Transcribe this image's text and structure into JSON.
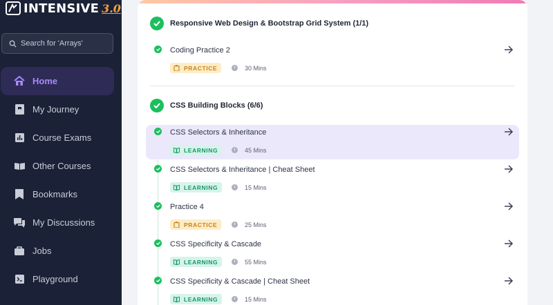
{
  "sidebar": {
    "logo_text": "INTENSIVE",
    "logo_version": "3.0",
    "search_placeholder": "Search for 'Arrays'",
    "items": [
      {
        "label": "Home",
        "icon": "home-icon",
        "active": true
      },
      {
        "label": "My Journey",
        "icon": "journey-icon",
        "active": false
      },
      {
        "label": "Course Exams",
        "icon": "chart-icon",
        "active": false
      },
      {
        "label": "Other Courses",
        "icon": "book-icon",
        "active": false
      },
      {
        "label": "Bookmarks",
        "icon": "bookmark-icon",
        "active": false
      },
      {
        "label": "My Discussions",
        "icon": "discussion-icon",
        "active": false
      },
      {
        "label": "Jobs",
        "icon": "briefcase-icon",
        "active": false
      },
      {
        "label": "Playground",
        "icon": "terminal-icon",
        "active": false
      }
    ]
  },
  "sections": [
    {
      "title": "Responsive Web Design & Bootstrap Grid System (1/1)",
      "items": [
        {
          "title": "Coding Practice 2",
          "badge": "PRACTICE",
          "duration": "30 Mins",
          "highlighted": false
        }
      ]
    },
    {
      "title": "CSS Building Blocks (6/6)",
      "items": [
        {
          "title": "CSS Selectors & Inheritance",
          "badge": "LEARNING",
          "duration": "45 Mins",
          "highlighted": true
        },
        {
          "title": "CSS Selectors & Inheritance | Cheat Sheet",
          "badge": "LEARNING",
          "duration": "15 Mins",
          "highlighted": false
        },
        {
          "title": "Practice 4",
          "badge": "PRACTICE",
          "duration": "25 Mins",
          "highlighted": false
        },
        {
          "title": "CSS Specificity & Cascade",
          "badge": "LEARNING",
          "duration": "55 Mins",
          "highlighted": false
        },
        {
          "title": "CSS Specificity & Cascade | Cheat Sheet",
          "badge": "LEARNING",
          "duration": "15 Mins",
          "highlighted": false
        }
      ]
    }
  ],
  "colors": {
    "sidebar_bg": "#1b2136",
    "accent": "#a78bfa",
    "success": "#1cbf5e",
    "practice": "#c9801a",
    "learning": "#16956b"
  }
}
